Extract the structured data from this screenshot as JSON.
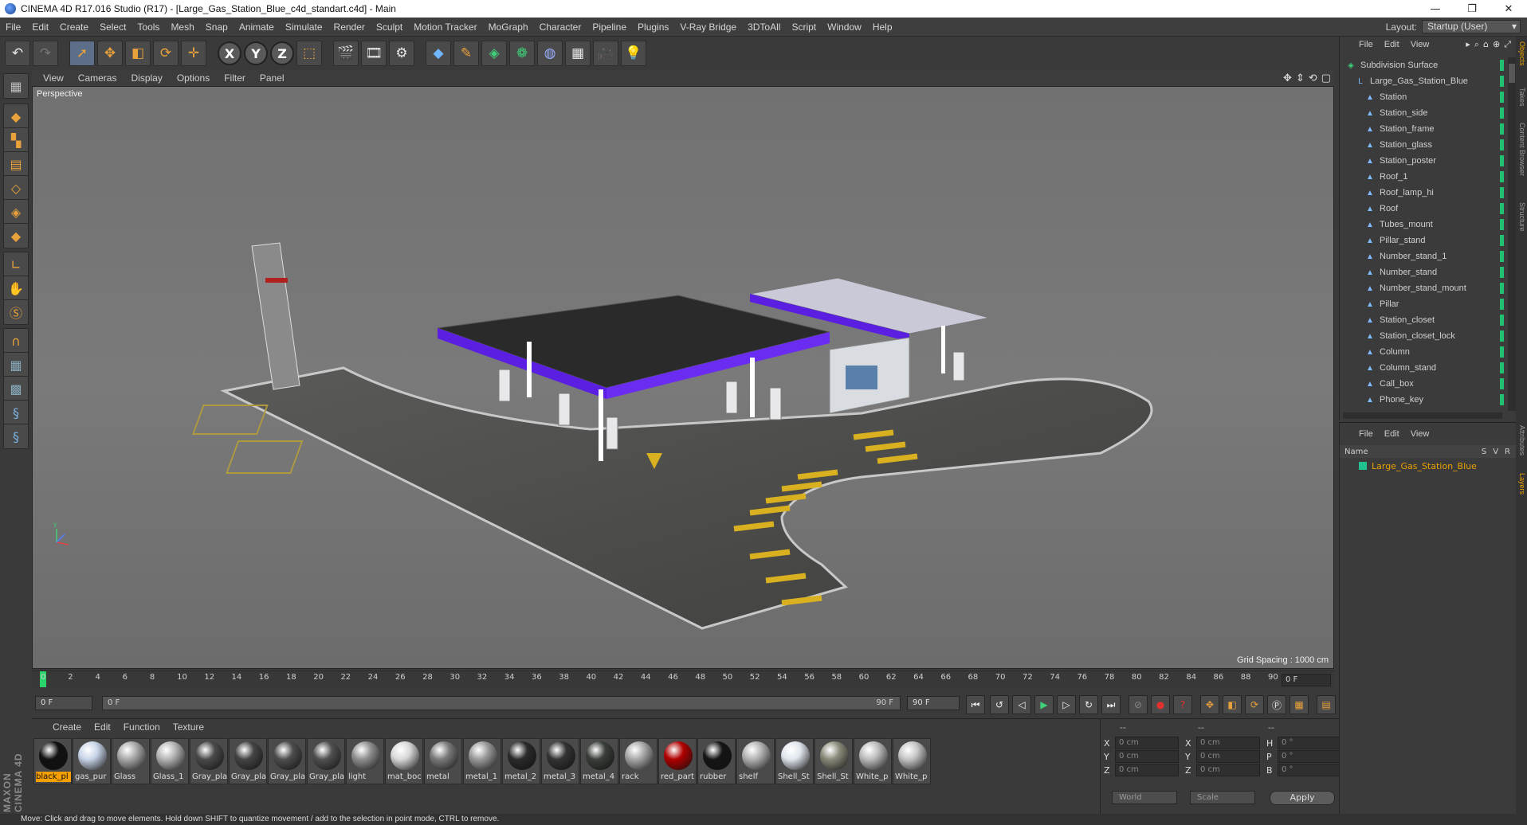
{
  "window": {
    "title": "CINEMA 4D R17.016 Studio (R17) - [Large_Gas_Station_Blue_c4d_standart.c4d] - Main",
    "controls": [
      "—",
      "❐",
      "✕"
    ]
  },
  "menubar": {
    "items": [
      "File",
      "Edit",
      "Create",
      "Select",
      "Tools",
      "Mesh",
      "Snap",
      "Animate",
      "Simulate",
      "Render",
      "Sculpt",
      "Motion Tracker",
      "MoGraph",
      "Character",
      "Pipeline",
      "Plugins",
      "V-Ray Bridge",
      "3DToAll",
      "Script",
      "Window",
      "Help"
    ],
    "layout_label": "Layout:",
    "layout_value": "Startup (User)"
  },
  "viewport": {
    "menu": [
      "View",
      "Cameras",
      "Display",
      "Options",
      "Filter",
      "Panel"
    ],
    "label": "Perspective",
    "grid_spacing": "Grid Spacing : 1000 cm"
  },
  "timeline": {
    "ticks": [
      "0",
      "2",
      "4",
      "6",
      "8",
      "10",
      "12",
      "14",
      "16",
      "18",
      "20",
      "22",
      "24",
      "26",
      "28",
      "30",
      "32",
      "34",
      "36",
      "38",
      "40",
      "42",
      "44",
      "46",
      "48",
      "50",
      "52",
      "54",
      "56",
      "58",
      "60",
      "62",
      "64",
      "66",
      "68",
      "70",
      "72",
      "74",
      "76",
      "78",
      "80",
      "82",
      "84",
      "86",
      "88",
      "90"
    ],
    "current_frame": "0 F",
    "start_field": "0 F",
    "slider_start": "0 F",
    "slider_end": "90 F",
    "end_field": "90 F"
  },
  "materials": {
    "menu": [
      "Create",
      "Edit",
      "Function",
      "Texture"
    ],
    "items": [
      {
        "label": "black_pl",
        "color": "#111111",
        "active": true
      },
      {
        "label": "gas_pur",
        "color": "#c8d4e8",
        "active": false
      },
      {
        "label": "Glass",
        "color": "#a9a9a9",
        "active": false
      },
      {
        "label": "Glass_1",
        "color": "#b4b4b4",
        "active": false
      },
      {
        "label": "Gray_pla",
        "color": "#4a4a4a",
        "active": false
      },
      {
        "label": "Gray_pla",
        "color": "#444444",
        "active": false
      },
      {
        "label": "Gray_pla",
        "color": "#4d4d4d",
        "active": false
      },
      {
        "label": "Gray_pla",
        "color": "#505050",
        "active": false
      },
      {
        "label": "light",
        "color": "#8e8e8e",
        "active": false
      },
      {
        "label": "mat_boc",
        "color": "#d8d8d8",
        "active": false
      },
      {
        "label": "metal",
        "color": "#7a7a7a",
        "active": false
      },
      {
        "label": "metal_1",
        "color": "#9a9a9a",
        "active": false
      },
      {
        "label": "metal_2",
        "color": "#2a2a2a",
        "active": false
      },
      {
        "label": "metal_3",
        "color": "#333333",
        "active": false
      },
      {
        "label": "metal_4",
        "color": "#3a3f3a",
        "active": false
      },
      {
        "label": "rack",
        "color": "#a8a8a8",
        "active": false
      },
      {
        "label": "red_part",
        "color": "#b00000",
        "active": false
      },
      {
        "label": "rubber",
        "color": "#151515",
        "active": false
      },
      {
        "label": "shelf",
        "color": "#b2b2b2",
        "active": false
      },
      {
        "label": "Shell_St",
        "color": "#e0e6ee",
        "active": false
      },
      {
        "label": "Shell_St",
        "color": "#8a8a7a",
        "active": false
      },
      {
        "label": "White_p",
        "color": "#bcbcbc",
        "active": false
      },
      {
        "label": "White_p",
        "color": "#c4c4c4",
        "active": false
      }
    ]
  },
  "coordinates": {
    "headers": [
      "--",
      "--",
      "--"
    ],
    "rows": [
      {
        "a": "X",
        "av": "0 cm",
        "b": "X",
        "bv": "0 cm",
        "c": "H",
        "cv": "0 °"
      },
      {
        "a": "Y",
        "av": "0 cm",
        "b": "Y",
        "bv": "0 cm",
        "c": "P",
        "cv": "0 °"
      },
      {
        "a": "Z",
        "av": "0 cm",
        "b": "Z",
        "bv": "0 cm",
        "c": "B",
        "cv": "0 °"
      }
    ],
    "mode": "World",
    "scale": "Scale",
    "apply": "Apply"
  },
  "object_manager": {
    "menu": [
      "File",
      "Edit",
      "View"
    ],
    "objects": [
      {
        "name": "Subdivision Surface",
        "indent": 0,
        "icon": "subdivision-icon"
      },
      {
        "name": "Large_Gas_Station_Blue",
        "indent": 1,
        "icon": "null-icon"
      },
      {
        "name": "Station",
        "indent": 2,
        "icon": "polygon-icon"
      },
      {
        "name": "Station_side",
        "indent": 2,
        "icon": "polygon-icon"
      },
      {
        "name": "Station_frame",
        "indent": 2,
        "icon": "polygon-icon"
      },
      {
        "name": "Station_glass",
        "indent": 2,
        "icon": "polygon-icon"
      },
      {
        "name": "Station_poster",
        "indent": 2,
        "icon": "polygon-icon"
      },
      {
        "name": "Roof_1",
        "indent": 2,
        "icon": "polygon-icon"
      },
      {
        "name": "Roof_lamp_hi",
        "indent": 2,
        "icon": "polygon-icon"
      },
      {
        "name": "Roof",
        "indent": 2,
        "icon": "polygon-icon"
      },
      {
        "name": "Tubes_mount",
        "indent": 2,
        "icon": "polygon-icon"
      },
      {
        "name": "Pillar_stand",
        "indent": 2,
        "icon": "polygon-icon"
      },
      {
        "name": "Number_stand_1",
        "indent": 2,
        "icon": "polygon-icon"
      },
      {
        "name": "Number_stand",
        "indent": 2,
        "icon": "polygon-icon"
      },
      {
        "name": "Number_stand_mount",
        "indent": 2,
        "icon": "polygon-icon"
      },
      {
        "name": "Pillar",
        "indent": 2,
        "icon": "polygon-icon"
      },
      {
        "name": "Station_closet",
        "indent": 2,
        "icon": "polygon-icon"
      },
      {
        "name": "Station_closet_lock",
        "indent": 2,
        "icon": "polygon-icon"
      },
      {
        "name": "Column",
        "indent": 2,
        "icon": "polygon-icon"
      },
      {
        "name": "Column_stand",
        "indent": 2,
        "icon": "polygon-icon"
      },
      {
        "name": "Call_box",
        "indent": 2,
        "icon": "polygon-icon"
      },
      {
        "name": "Phone_key",
        "indent": 2,
        "icon": "polygon-icon"
      }
    ]
  },
  "layer_manager": {
    "menu": [
      "File",
      "Edit",
      "View"
    ],
    "header_name": "Name",
    "header_cols": [
      "S",
      "V",
      "R"
    ],
    "layers": [
      {
        "name": "Large_Gas_Station_Blue",
        "color": "#20c090"
      }
    ]
  },
  "side_tabs": [
    "Objects",
    "Takes",
    "Content Browser",
    "Structure",
    "Attributes",
    "Layers"
  ],
  "status": "Move: Click and drag to move elements. Hold down SHIFT to quantize movement / add to the selection in point mode, CTRL to remove."
}
